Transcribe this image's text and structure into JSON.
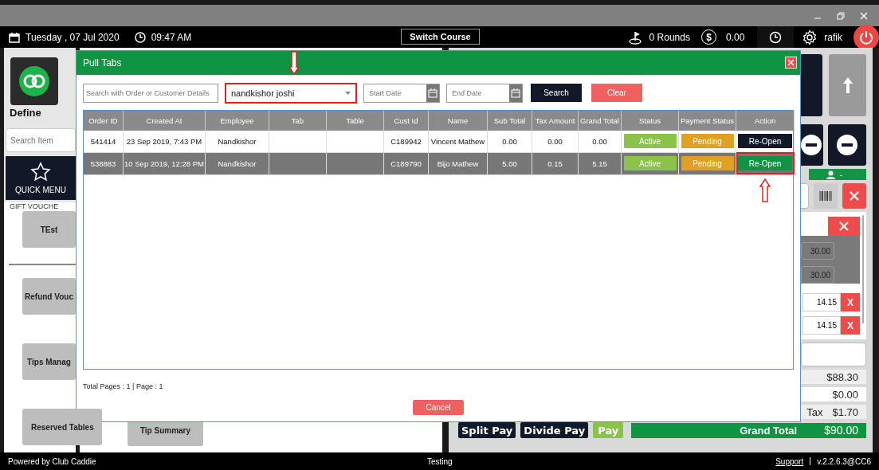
{
  "top_bar": {
    "date": "Tuesday , 07 Jul 2020",
    "time": "09:47 AM",
    "switch_course": "Switch Course",
    "rounds": "0 Rounds",
    "currency_symbol": "$",
    "balance": "0.00",
    "user": "rafik"
  },
  "left_panel": {
    "title": "Define",
    "search_placeholder": "Search Item",
    "quick_menu": "QUICK MENU",
    "section_label": "GIFT VOUCHE",
    "buttons": [
      "TEst",
      "Refund Vouc",
      "Tips Manag",
      "Reserved Tables"
    ]
  },
  "center_panel": {
    "buttons": [
      "Tip Summary"
    ]
  },
  "right_panel": {
    "customer": "-",
    "item_amounts": [
      "30.00",
      "30.00"
    ],
    "tip_amounts": [
      {
        "amount": "14.15",
        "remove": "X"
      },
      {
        "amount": "14.15",
        "remove": "X"
      }
    ],
    "totals": [
      {
        "value": "$88.30"
      },
      {
        "value": "$0.00"
      },
      {
        "label": "Tax",
        "value": "$1.70"
      }
    ],
    "pay_buttons": [
      {
        "label": "Split Pay",
        "kind": "dark"
      },
      {
        "label": "Divide Pay",
        "kind": "dark"
      },
      {
        "label": "Pay",
        "kind": "green"
      }
    ],
    "grand_total": {
      "label": "Grand Total",
      "value": "$90.00"
    }
  },
  "modal": {
    "title": "Pull Tabs",
    "search_placeholder": "Search with Order or Customer Details",
    "employee": "nandkishor joshi",
    "employee_highlighted": true,
    "start_date_placeholder": "Start Date",
    "end_date_placeholder": "End Date",
    "search": "Search",
    "clear": "Clear",
    "columns": [
      "Order ID",
      "Created At",
      "Employee",
      "Tab",
      "Table",
      "Cust Id",
      "Name",
      "Sub Total",
      "Tax Amount",
      "Grand Total",
      "Status",
      "Payment Status",
      "Action"
    ],
    "rows": [
      {
        "selected": false,
        "action_highlighted": false,
        "cells": [
          "541414",
          "23 Sep 2019, 7:43 PM",
          "Nandkishor",
          "",
          "",
          "C189942",
          "Vincent Mathew",
          "0.00",
          "0.00",
          "0.00"
        ],
        "status": "Active",
        "payment_status": "Pending",
        "action": "Re-Open"
      },
      {
        "selected": true,
        "action_highlighted": true,
        "cells": [
          "538883",
          "10 Sep 2019, 12:28 PM",
          "Nandkishor",
          "",
          "",
          "C189790",
          "Bijo Mathew",
          "5.00",
          "0.15",
          "5.15"
        ],
        "status": "Active",
        "payment_status": "Pending",
        "action": "Re-Open"
      }
    ],
    "pagination": "Total Pages : 1 | Page : 1",
    "cancel": "Cancel"
  },
  "footer": {
    "left": "Powered by Club Caddie",
    "center": "Testing",
    "support": "Support",
    "version": "v.2.2.6.3@CC6"
  }
}
